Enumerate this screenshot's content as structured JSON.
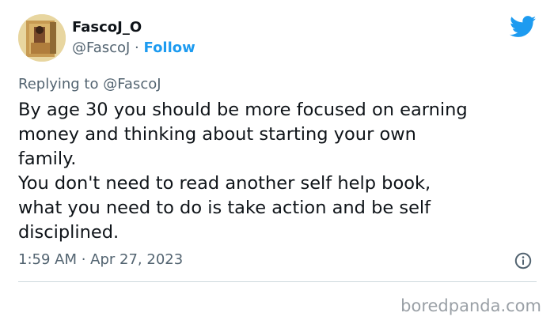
{
  "author": {
    "display_name": "FascoJ_O",
    "handle": "@FascoJ",
    "separator": " · ",
    "follow_label": "Follow"
  },
  "brand_icon": "twitter-bird-icon",
  "reply": {
    "prefix": "Replying to ",
    "handle": "@FascoJ"
  },
  "tweet": {
    "lines": [
      "By age 30 you should be more focused on earning",
      "money and thinking about starting your own",
      "family.",
      "You don't need to read another self help book,",
      "what you need to do is take action and be self",
      "disciplined."
    ]
  },
  "meta": {
    "timestamp": "1:59 AM · Apr 27, 2023",
    "info_icon": "info-icon"
  },
  "watermark": "boredpanda.com",
  "colors": {
    "accent": "#1d9bf0",
    "text": "#0f1419",
    "muted": "#536471",
    "divider": "#cfd9de",
    "watermark": "#9aa0a6"
  }
}
